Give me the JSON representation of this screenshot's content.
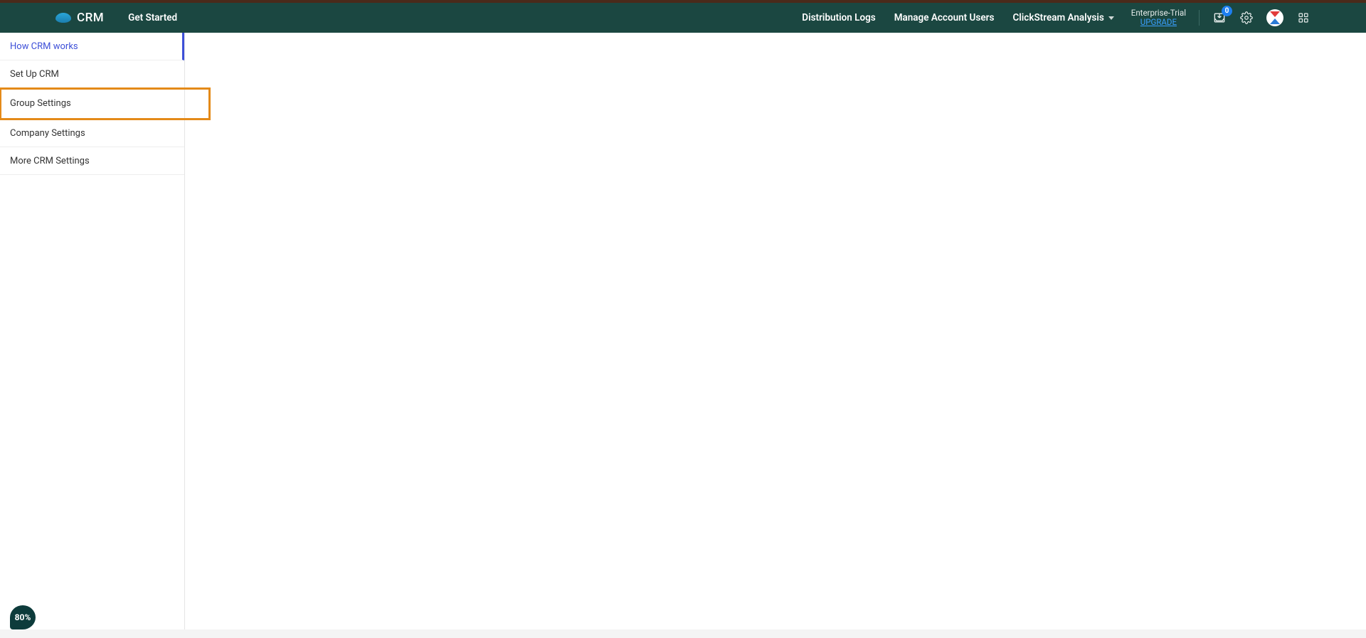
{
  "brand": {
    "name": "CRM"
  },
  "page_title": "Get Started",
  "nav": {
    "items": [
      {
        "label": "Distribution Logs"
      },
      {
        "label": "Manage Account Users"
      },
      {
        "label": "ClickStream Analysis",
        "has_dropdown": true
      }
    ]
  },
  "trial": {
    "plan": "Enterprise-Trial",
    "cta": "UPGRADE"
  },
  "notifications": {
    "count": "0"
  },
  "sidebar": {
    "items": [
      {
        "label": "How CRM works",
        "state": "active"
      },
      {
        "label": "Set Up CRM",
        "state": ""
      },
      {
        "label": "Group Settings",
        "state": "highlighted"
      },
      {
        "label": "Company Settings",
        "state": ""
      },
      {
        "label": "More CRM Settings",
        "state": ""
      }
    ]
  },
  "progress": {
    "pct": "80%"
  }
}
